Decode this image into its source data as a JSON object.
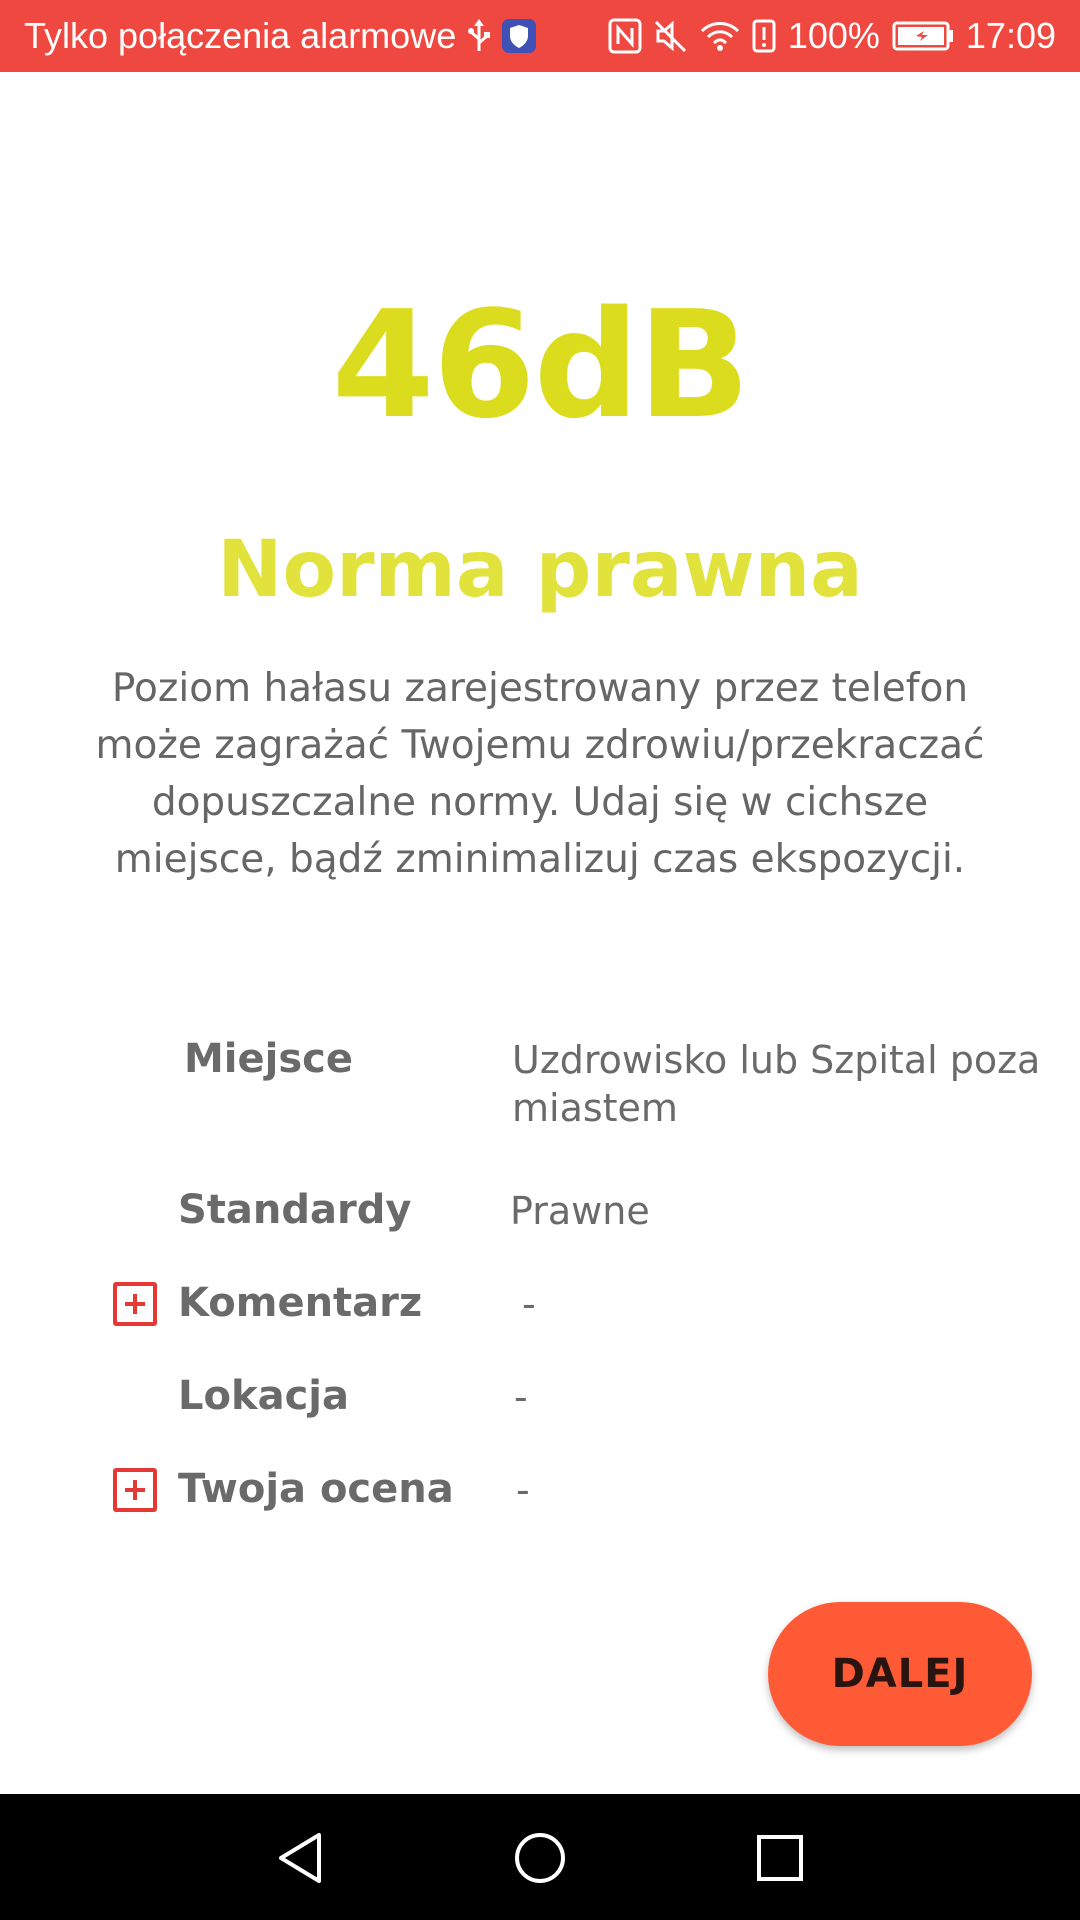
{
  "status_bar": {
    "carrier_text": "Tylko połączenia alarmowe",
    "battery_percent": "100%",
    "time": "17:09",
    "icons": [
      "usb-icon",
      "shield-app-icon",
      "nfc-icon",
      "mute-icon",
      "wifi-icon",
      "alert-icon",
      "battery-icon"
    ]
  },
  "measurement": {
    "value": "46dB",
    "color": "#dcdc1e"
  },
  "assessment": {
    "title": "Norma prawna",
    "description": "Poziom hałasu zarejestrowany przez telefon może zagrażać Twojemu zdrowiu/przekraczać dopuszczalne normy. Udaj się w cichsze miejsce, bądź zminimalizuj czas ekspozycji."
  },
  "details": {
    "place": {
      "label": "Miejsce",
      "value": "Uzdrowisko lub Szpital poza miastem"
    },
    "standards": {
      "label": "Standardy",
      "value": "Prawne"
    },
    "comment": {
      "label": "Komentarz",
      "value": "-"
    },
    "location": {
      "label": "Lokacja",
      "value": "-"
    },
    "rating": {
      "label": "Twoja ocena",
      "value": "-"
    }
  },
  "actions": {
    "next_label": "DALEJ",
    "accent": "#ff5a36"
  },
  "nav_bar": {
    "icons": [
      "back-icon",
      "home-icon",
      "recents-icon"
    ]
  }
}
